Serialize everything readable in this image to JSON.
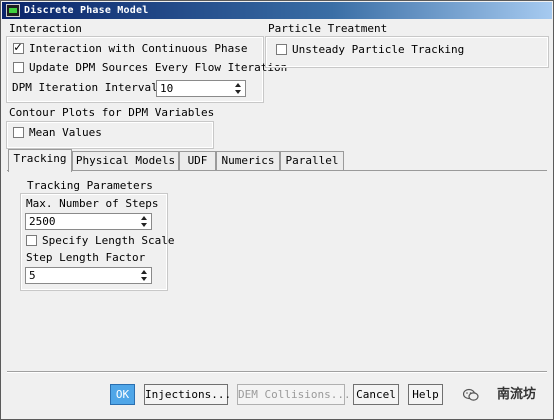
{
  "window": {
    "title": "Discrete Phase Model"
  },
  "interaction": {
    "label": "Interaction",
    "continuous_phase": {
      "label": "Interaction with Continuous Phase",
      "checked": true
    },
    "update_sources": {
      "label": "Update DPM Sources Every Flow Iteration",
      "checked": false
    },
    "iteration_interval": {
      "label": "DPM Iteration Interval",
      "value": "10"
    }
  },
  "particle_treatment": {
    "label": "Particle Treatment",
    "unsteady": {
      "label": "Unsteady Particle Tracking",
      "checked": false
    }
  },
  "contour_plots": {
    "label": "Contour Plots for DPM Variables",
    "mean_values": {
      "label": "Mean Values",
      "checked": false
    }
  },
  "tabs": [
    {
      "label": "Tracking",
      "active": true
    },
    {
      "label": "Physical Models",
      "active": false
    },
    {
      "label": "UDF",
      "active": false
    },
    {
      "label": "Numerics",
      "active": false
    },
    {
      "label": "Parallel",
      "active": false
    }
  ],
  "tracking": {
    "group_label": "Tracking Parameters",
    "max_steps": {
      "label": "Max. Number of Steps",
      "value": "2500"
    },
    "specify_length_scale": {
      "label": "Specify Length Scale",
      "checked": false
    },
    "step_length_factor": {
      "label": "Step Length Factor",
      "value": "5"
    }
  },
  "buttons": {
    "ok": "OK",
    "injections": "Injections...",
    "dem_collisions": "DEM Collisions...",
    "cancel": "Cancel",
    "help": "Help"
  },
  "watermark": {
    "text": "南流坊",
    "icon": "wechat-logo-icon"
  },
  "colors": {
    "titlebar": "#0a246a",
    "ok_button": "#4fa6e8",
    "check": "#000000"
  }
}
